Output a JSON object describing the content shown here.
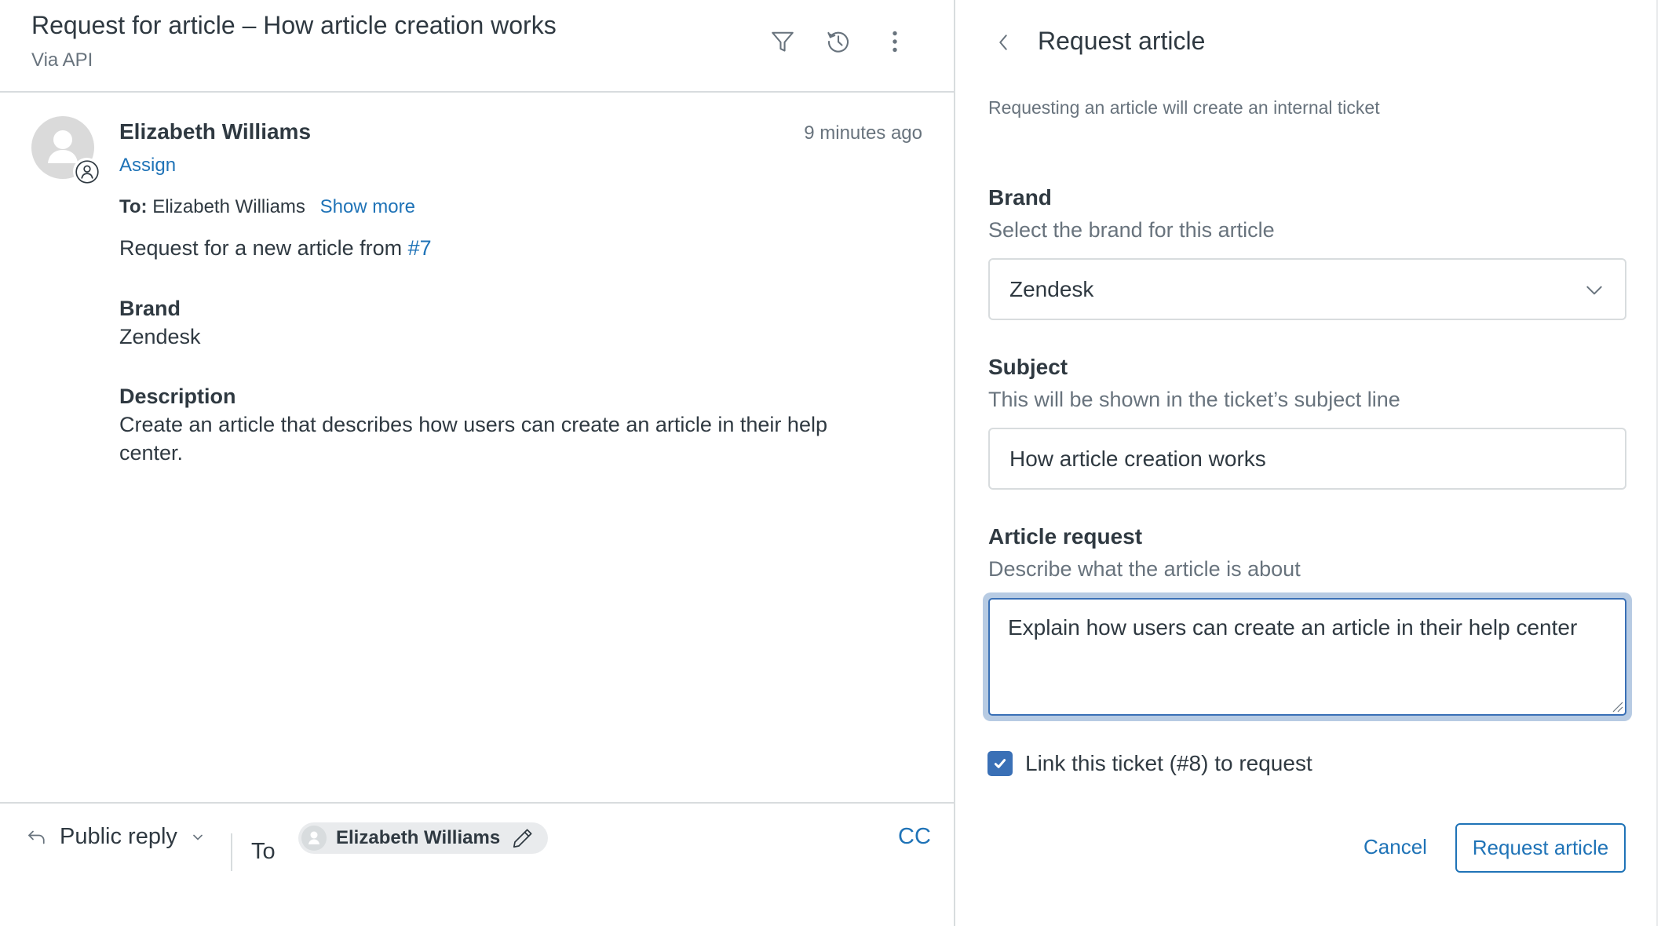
{
  "ticket": {
    "title": "Request for article – How article creation works",
    "via": "Via API",
    "toolbar_icons": [
      "filter-icon",
      "history-icon",
      "more-options-icon"
    ]
  },
  "message": {
    "author": "Elizabeth Williams",
    "time": "9 minutes ago",
    "assign_label": "Assign",
    "to_prefix": "To:",
    "to_name": "Elizabeth Williams",
    "show_more_label": "Show more",
    "body_intro": "Request for a new article from ",
    "body_link": "#7",
    "brand_heading": "Brand",
    "brand_value": "Zendesk",
    "description_heading": "Description",
    "description_line1": "Create an article that describes how users can create an article in their help",
    "description_line2": "center."
  },
  "reply_bar": {
    "reply_type": "Public reply",
    "to_label": "To",
    "recipient": "Elizabeth Williams",
    "cc_label": "CC"
  },
  "panel": {
    "title": "Request article",
    "intro": "Requesting an article will create an internal ticket",
    "brand": {
      "label": "Brand",
      "hint": "Select the brand for this article",
      "value": "Zendesk"
    },
    "subject": {
      "label": "Subject",
      "hint": "This will be shown in the ticket’s subject line",
      "value": "How article creation works"
    },
    "article_request": {
      "label": "Article request",
      "hint": "Describe what the article is about",
      "value": "Explain how users can create an article in their help center"
    },
    "link_ticket": {
      "label": "Link this ticket (#8) to request",
      "checked": true
    },
    "cancel_label": "Cancel",
    "submit_label": "Request article"
  },
  "colors": {
    "accent": "#1f73b7",
    "checkbox": "#3a70b6",
    "focus_ring": "#b7cbe3",
    "text": "#2f3941",
    "muted": "#68737d",
    "border": "#d8dcde"
  }
}
